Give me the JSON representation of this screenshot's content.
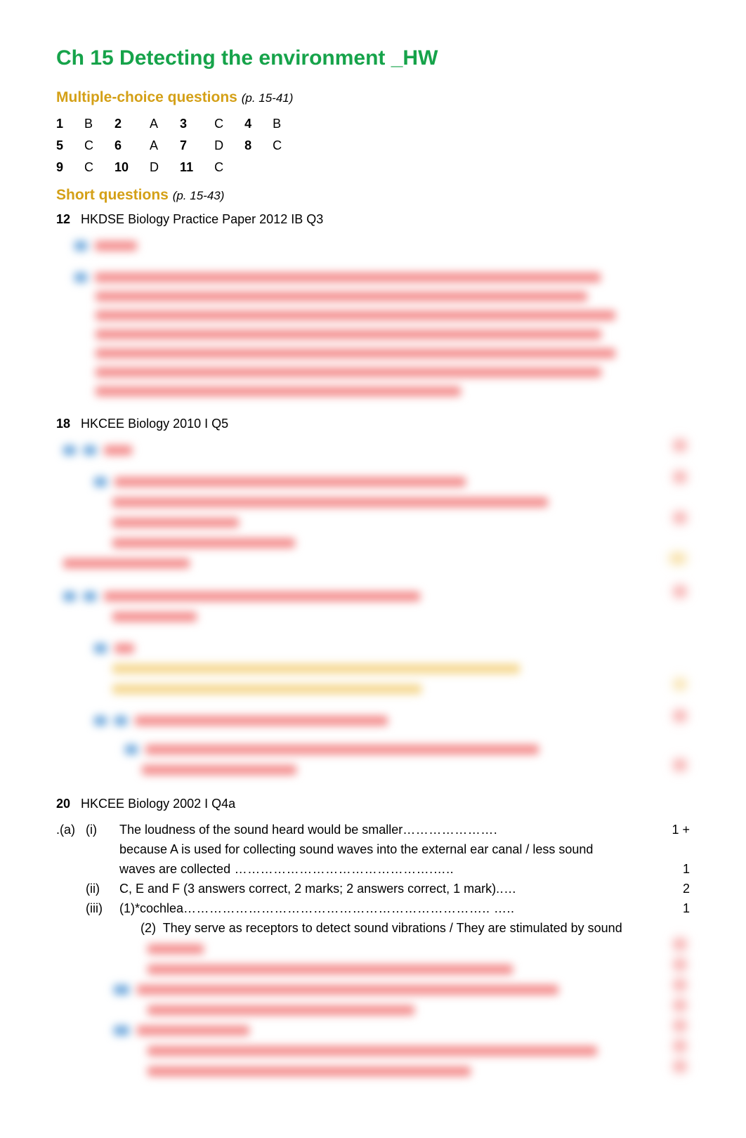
{
  "title": "Ch 15 Detecting the environment _HW",
  "mc": {
    "heading": "Multiple-choice questions",
    "pageRef": "(p. 15-41)",
    "items": [
      {
        "n": "1",
        "a": "B"
      },
      {
        "n": "2",
        "a": "A"
      },
      {
        "n": "3",
        "a": "C"
      },
      {
        "n": "4",
        "a": "B"
      },
      {
        "n": "5",
        "a": "C"
      },
      {
        "n": "6",
        "a": "A"
      },
      {
        "n": "7",
        "a": "D"
      },
      {
        "n": "8",
        "a": "C"
      },
      {
        "n": "9",
        "a": "C"
      },
      {
        "n": "10",
        "a": "D"
      },
      {
        "n": "11",
        "a": "C"
      }
    ]
  },
  "sq": {
    "heading": "Short questions",
    "pageRef": "(p. 15-43)"
  },
  "q12": {
    "num": "12",
    "text": "HKDSE Biology Practice Paper 2012 IB Q3"
  },
  "q18": {
    "num": "18",
    "text": "HKCEE Biology 2010 I Q5"
  },
  "q20": {
    "num": "20",
    "text": "HKCEE Biology 2002 I Q4a",
    "a": {
      "label": ".(a)",
      "i": {
        "label": "(i)",
        "line1_pre": "The loudness of the sound heard would be smaller",
        "line1_dots": "…………………. ",
        "line1_mark": "1 +",
        "line2_pre": "because A is used for collecting sound waves into the external ear canal / less sound",
        "line3_pre": "waves are collected",
        "line3_dots": " ……………………………………….….. ",
        "line3_mark": "1"
      },
      "ii": {
        "label": "(ii)",
        "text": "C, E and F (3 answers correct, 2 marks; 2 answers correct, 1 mark)",
        "dots": "..… ",
        "mark": "2"
      },
      "iii": {
        "label": "(iii)",
        "part1_label": "(1)",
        "part1_text": "*cochlea",
        "part1_dots": "…………………………………………………………….. ….. ",
        "part1_mark": "1",
        "part2_label": "(2)",
        "part2_text": "They serve as receptors to detect sound vibrations / They are stimulated by sound"
      }
    }
  }
}
